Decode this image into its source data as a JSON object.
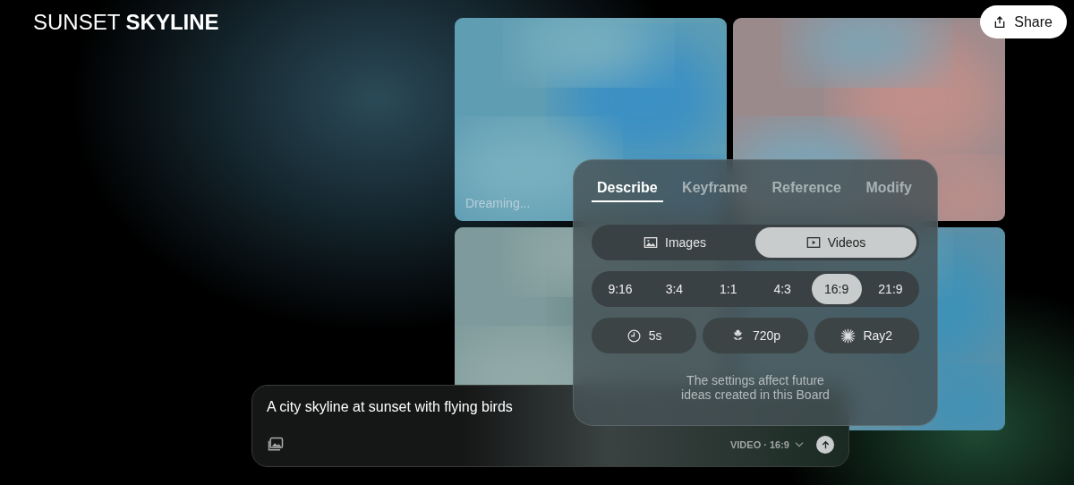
{
  "header": {
    "title": "SUNSET **SKYLINE**",
    "share_button": "Share"
  },
  "tiles": [
    {
      "kind": "picture",
      "caption": "Dreaming..."
    },
    {
      "kind": "picture"
    },
    {
      "kind": "picture"
    },
    {
      "kind": "picture"
    }
  ],
  "settings_panel": {
    "tabs": [
      {
        "label": "Describe",
        "selected": true
      },
      {
        "label": "Keyframe",
        "selected": false
      },
      {
        "label": "Reference",
        "selected": false
      },
      {
        "label": "Modify",
        "selected": false
      }
    ],
    "media_types": [
      {
        "kind": "images",
        "label": "Images",
        "selected": false
      },
      {
        "kind": "videos",
        "label": "Videos",
        "selected": true
      }
    ],
    "aspect_ratios": [
      {
        "label": "9:16",
        "selected": false
      },
      {
        "label": "3:4",
        "selected": false
      },
      {
        "label": "1:1",
        "selected": false
      },
      {
        "label": "4:3",
        "selected": false
      },
      {
        "label": "16:9",
        "selected": true
      },
      {
        "label": "21:9",
        "selected": false
      }
    ],
    "options": [
      {
        "kind": "duration",
        "label": "5s"
      },
      {
        "kind": "resolution",
        "label": "720p"
      },
      {
        "kind": "model",
        "label": "Ray2"
      }
    ],
    "note": "The settings affect future ideas created in this Board"
  },
  "prompt": {
    "value": "A city skyline at sunset with flying birds",
    "mode": "VIDEO · 16:9"
  }
}
